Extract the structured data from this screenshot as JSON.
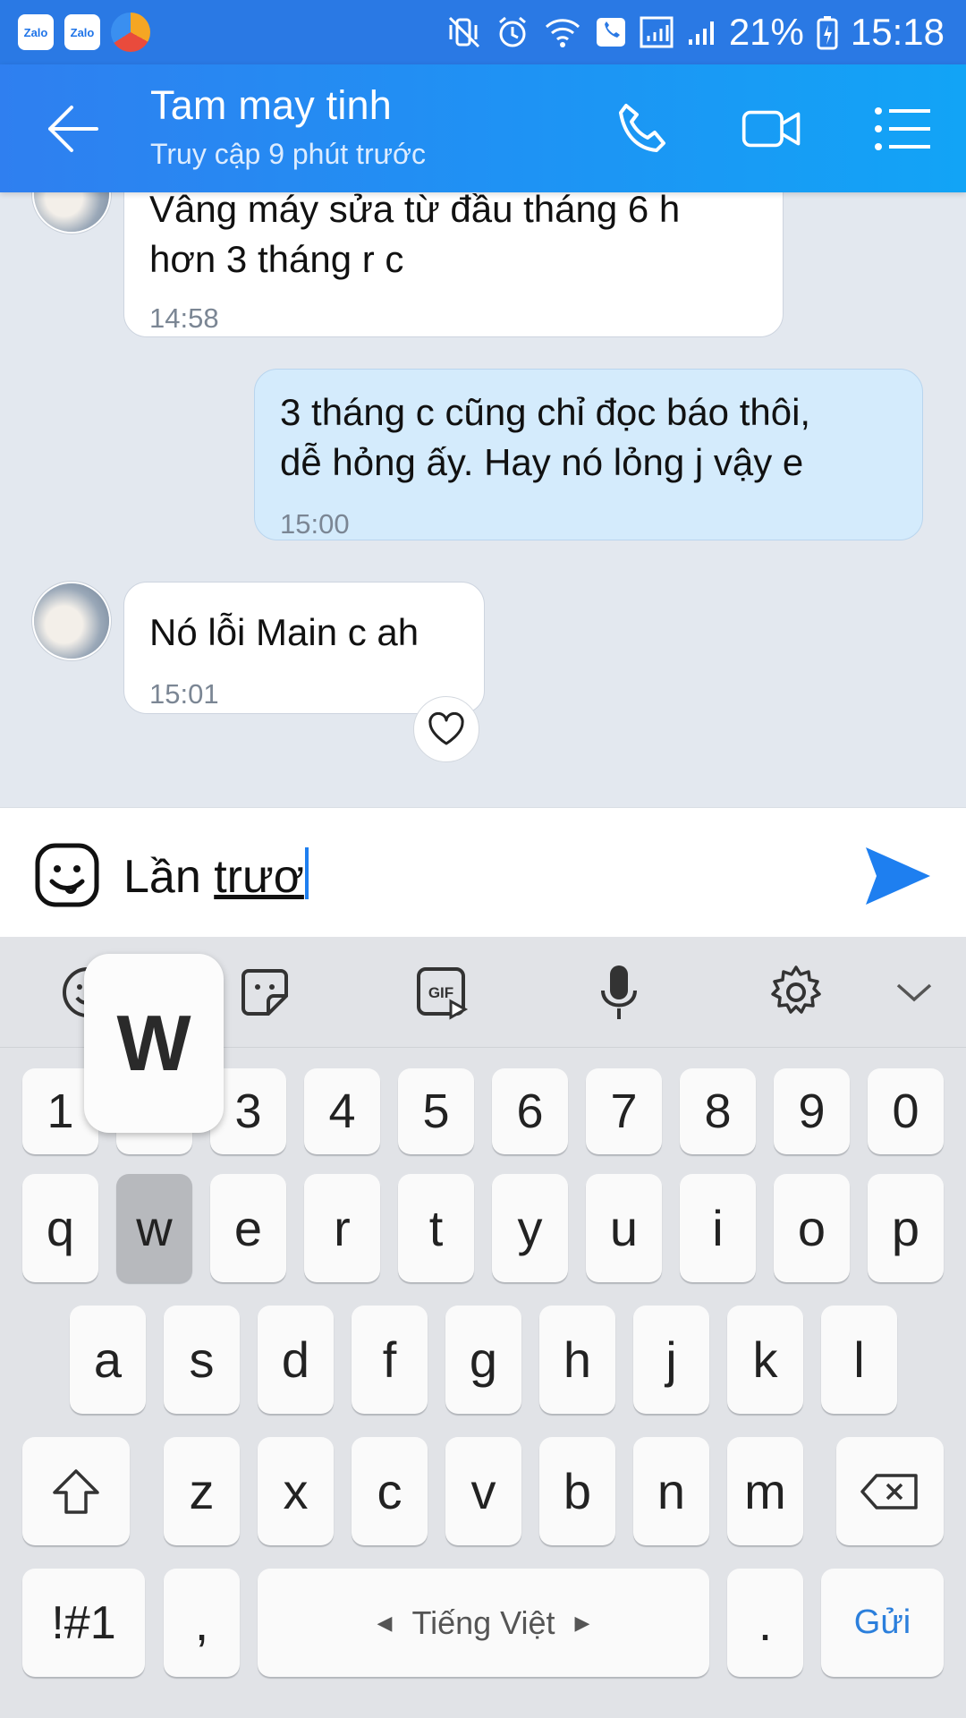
{
  "status_bar": {
    "app_badge_1": "Zalo",
    "app_badge_2": "Zalo",
    "battery": "21%",
    "time": "15:18"
  },
  "header": {
    "title": "Tam may tinh",
    "subtitle": "Truy cập 9 phút trước"
  },
  "messages": [
    {
      "sender": "other",
      "line1": "Vâng máy sửa từ đầu tháng 6 h",
      "line2": "hơn 3 tháng r c",
      "time": "14:58"
    },
    {
      "sender": "me",
      "line1": "3 tháng c cũng chỉ đọc báo thôi,",
      "line2": "dễ hỏng ấy. Hay nó lỏng j vậy e",
      "time": "15:00"
    },
    {
      "sender": "other",
      "line1": "Nó lỗi Main c ah",
      "time": "15:01"
    }
  ],
  "composer": {
    "text_plain": "Lần ",
    "text_composing": "trươ"
  },
  "keyboard": {
    "popup_key": "W",
    "number_row": [
      "1",
      "2",
      "3",
      "4",
      "5",
      "6",
      "7",
      "8",
      "9",
      "0"
    ],
    "row1": [
      "q",
      "w",
      "e",
      "r",
      "t",
      "y",
      "u",
      "i",
      "o",
      "p"
    ],
    "row2": [
      "a",
      "s",
      "d",
      "f",
      "g",
      "h",
      "j",
      "k",
      "l"
    ],
    "row3": [
      "z",
      "x",
      "c",
      "v",
      "b",
      "n",
      "m"
    ],
    "symbols_label": "!#1",
    "comma": ",",
    "space_label": "Tiếng Việt",
    "period": ".",
    "send_label": "Gửi",
    "pressed_key": "w"
  },
  "colors": {
    "header_start": "#2f7ff0",
    "header_end": "#12a4f6",
    "my_bubble": "#d4ebfc",
    "accent": "#1e7ff0"
  }
}
